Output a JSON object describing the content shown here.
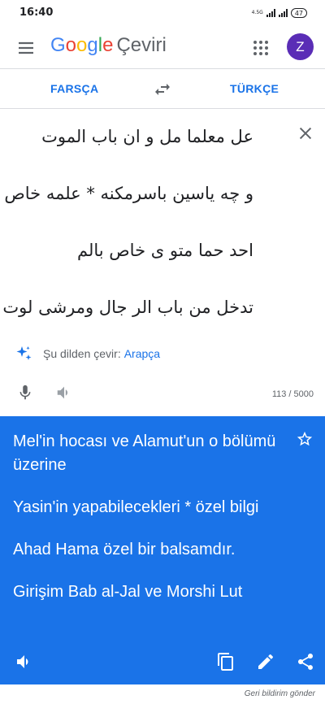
{
  "status_bar": {
    "time": "16:40",
    "network": "4.5G",
    "battery": "47"
  },
  "app_bar": {
    "logo_letters": [
      {
        "char": "G",
        "color": "#4285f4"
      },
      {
        "char": "o",
        "color": "#ea4335"
      },
      {
        "char": "o",
        "color": "#fbbc05"
      },
      {
        "char": "g",
        "color": "#4285f4"
      },
      {
        "char": "l",
        "color": "#34a853"
      },
      {
        "char": "e",
        "color": "#ea4335"
      }
    ],
    "product": "Çeviri",
    "avatar_initial": "Z",
    "avatar_color": "#5a2db6"
  },
  "languages": {
    "source": "FARSÇA",
    "target": "TÜRKÇE"
  },
  "source": {
    "lines": [
      "عل معلما مل و ان باب الموت",
      "و چه یاسین باسرمکنه * علمه خاص",
      "احد حما متو ی خاص بالم",
      "تدخل من باب الر جال ومرشی لوت"
    ],
    "detect_label": "Şu dilden çevir:",
    "detect_language": "Arapça",
    "char_count": "113 / 5000"
  },
  "result": {
    "paragraphs": [
      "Mel'in hocası ve Alamut'un o bölümü üzerine",
      "Yasin'in yapabilecekleri * özel bilgi",
      "Ahad Hama özel bir balsamdır.",
      "Girişim Bab al-Jal ve Morshi Lut"
    ],
    "background": "#1a73e8"
  },
  "feedback": "Geri bildirim gönder",
  "colors": {
    "accent": "#1a73e8",
    "icon_grey": "#5f6368",
    "text_dark": "#202124"
  }
}
